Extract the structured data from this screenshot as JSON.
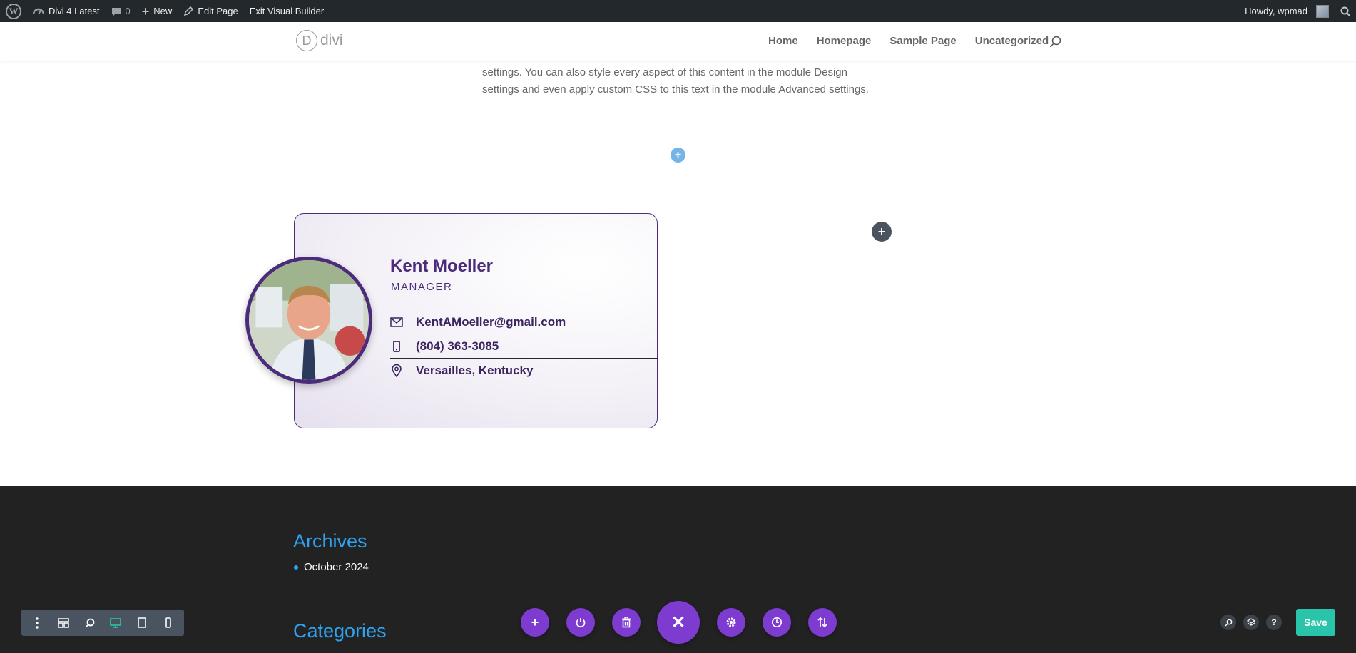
{
  "admin_bar": {
    "site_name": "Divi 4 Latest",
    "comments_count": "0",
    "new_label": "New",
    "edit_page_label": "Edit Page",
    "exit_builder_label": "Exit Visual Builder",
    "greeting": "Howdy, wpmad"
  },
  "header": {
    "logo_letter": "D",
    "logo_text": "divi",
    "nav": [
      "Home",
      "Homepage",
      "Sample Page",
      "Uncategorized"
    ]
  },
  "body": {
    "text_line1": "settings. You can also style every aspect of this content in the module Design",
    "text_line2": "settings and even apply custom CSS to this text in the module Advanced settings."
  },
  "card": {
    "name": "Kent Moeller",
    "role": "MANAGER",
    "email": "KentAMoeller@gmail.com",
    "phone": "(804) 363-3085",
    "location": "Versailles, Kentucky"
  },
  "footer": {
    "archives_title": "Archives",
    "archives": [
      "October 2024"
    ],
    "categories_title": "Categories"
  },
  "builder": {
    "save_label": "Save",
    "help_label": "?",
    "close_symbol": "✕",
    "add_symbol": "+"
  },
  "colors": {
    "accent": "#4b2b7a",
    "builder_purple": "#7e3bd0",
    "save_green": "#29c4a9",
    "footer_link": "#2ea3f2",
    "admin_bar": "#23282d",
    "footer_bg": "#222222"
  }
}
